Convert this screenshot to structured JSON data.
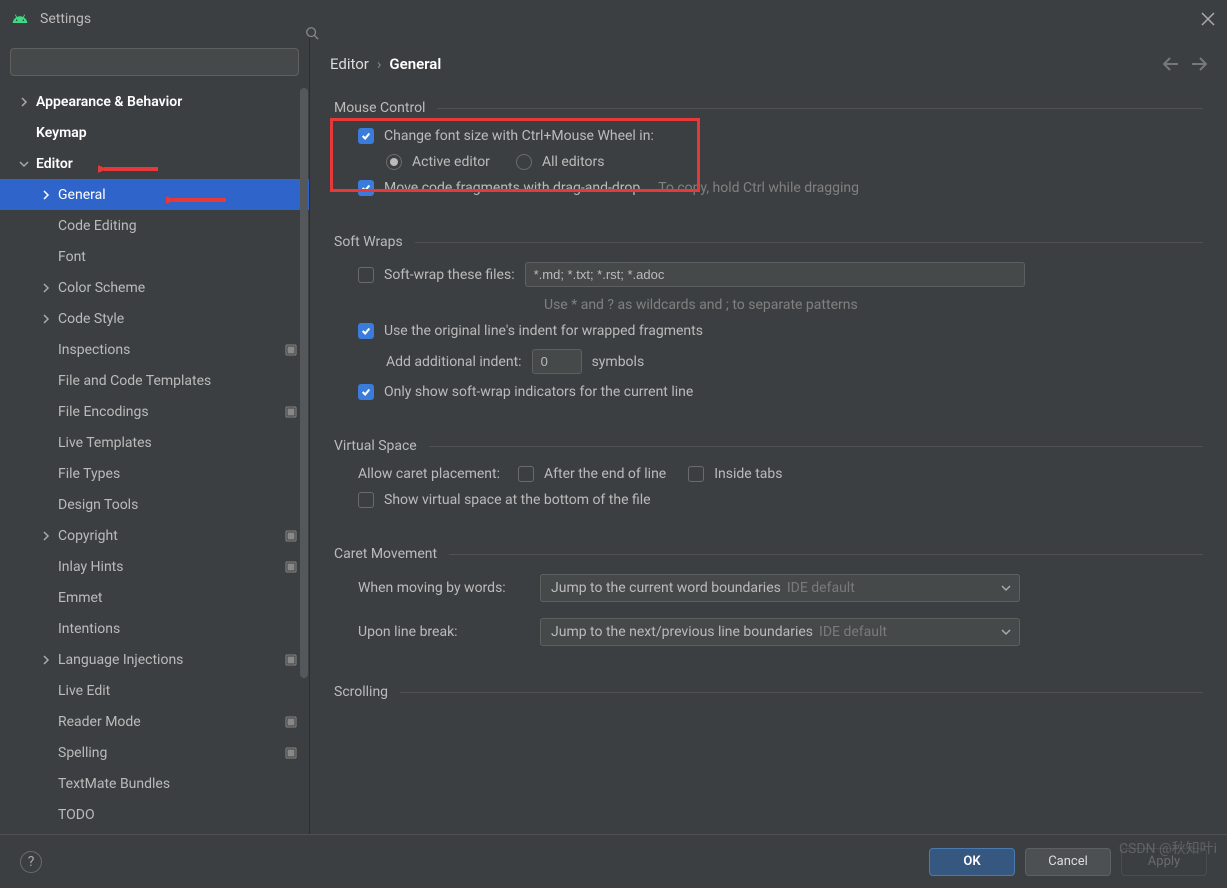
{
  "window": {
    "title": "Settings"
  },
  "search": {
    "placeholder": ""
  },
  "tree": [
    {
      "label": "Appearance & Behavior",
      "level": 0,
      "expandable": true,
      "expanded": false,
      "bold": true
    },
    {
      "label": "Keymap",
      "level": 0,
      "expandable": false,
      "bold": true
    },
    {
      "label": "Editor",
      "level": 0,
      "expandable": true,
      "expanded": true,
      "bold": true
    },
    {
      "label": "General",
      "level": 1,
      "expandable": true,
      "expanded": false,
      "selected": true
    },
    {
      "label": "Code Editing",
      "level": 1,
      "expandable": false
    },
    {
      "label": "Font",
      "level": 1,
      "expandable": false
    },
    {
      "label": "Color Scheme",
      "level": 1,
      "expandable": true,
      "expanded": false
    },
    {
      "label": "Code Style",
      "level": 1,
      "expandable": true,
      "expanded": false
    },
    {
      "label": "Inspections",
      "level": 1,
      "expandable": false,
      "cfg": true
    },
    {
      "label": "File and Code Templates",
      "level": 1,
      "expandable": false
    },
    {
      "label": "File Encodings",
      "level": 1,
      "expandable": false,
      "cfg": true
    },
    {
      "label": "Live Templates",
      "level": 1,
      "expandable": false
    },
    {
      "label": "File Types",
      "level": 1,
      "expandable": false
    },
    {
      "label": "Design Tools",
      "level": 1,
      "expandable": false
    },
    {
      "label": "Copyright",
      "level": 1,
      "expandable": true,
      "expanded": false,
      "cfg": true
    },
    {
      "label": "Inlay Hints",
      "level": 1,
      "expandable": false,
      "cfg": true
    },
    {
      "label": "Emmet",
      "level": 1,
      "expandable": false
    },
    {
      "label": "Intentions",
      "level": 1,
      "expandable": false
    },
    {
      "label": "Language Injections",
      "level": 1,
      "expandable": true,
      "expanded": false,
      "cfg": true
    },
    {
      "label": "Live Edit",
      "level": 1,
      "expandable": false
    },
    {
      "label": "Reader Mode",
      "level": 1,
      "expandable": false,
      "cfg": true
    },
    {
      "label": "Spelling",
      "level": 1,
      "expandable": false,
      "cfg": true
    },
    {
      "label": "TextMate Bundles",
      "level": 1,
      "expandable": false
    },
    {
      "label": "TODO",
      "level": 1,
      "expandable": false
    }
  ],
  "breadcrumb": {
    "parent": "Editor",
    "current": "General"
  },
  "sections": {
    "mouse": {
      "title": "Mouse Control",
      "change_font": {
        "label": "Change font size with Ctrl+Mouse Wheel in:",
        "checked": true
      },
      "active_editor": {
        "label": "Active editor",
        "checked": true
      },
      "all_editors": {
        "label": "All editors",
        "checked": false
      },
      "move_drag": {
        "label": "Move code fragments with drag-and-drop",
        "checked": true
      },
      "move_drag_hint": "To copy, hold Ctrl while dragging"
    },
    "softwraps": {
      "title": "Soft Wraps",
      "softwrap_files": {
        "label": "Soft-wrap these files:",
        "checked": false,
        "value": "*.md; *.txt; *.rst; *.adoc"
      },
      "wildcard_hint": "Use * and ? as wildcards and ; to separate patterns",
      "use_indent": {
        "label": "Use the original line's indent for wrapped fragments",
        "checked": true
      },
      "add_indent_label": "Add additional indent:",
      "add_indent_value": "0",
      "add_indent_suffix": "symbols",
      "only_show": {
        "label": "Only show soft-wrap indicators for the current line",
        "checked": true
      }
    },
    "virtual": {
      "title": "Virtual Space",
      "allow_caret_label": "Allow caret placement:",
      "after_eol": {
        "label": "After the end of line",
        "checked": false
      },
      "inside_tabs": {
        "label": "Inside tabs",
        "checked": false
      },
      "show_virtual": {
        "label": "Show virtual space at the bottom of the file",
        "checked": false
      }
    },
    "caret": {
      "title": "Caret Movement",
      "by_words_label": "When moving by words:",
      "by_words_value": "Jump to the current word boundaries",
      "by_words_default": "IDE default",
      "line_break_label": "Upon line break:",
      "line_break_value": "Jump to the next/previous line boundaries",
      "line_break_default": "IDE default"
    },
    "scrolling": {
      "title": "Scrolling"
    }
  },
  "footer": {
    "ok": "OK",
    "cancel": "Cancel",
    "apply": "Apply"
  },
  "watermark": "CSDN @秋知叶i"
}
